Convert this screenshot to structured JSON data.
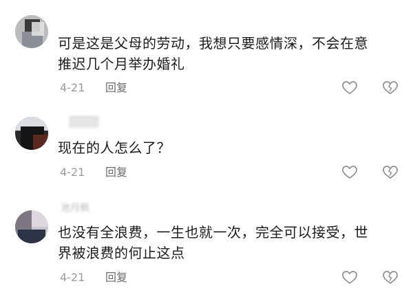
{
  "comments": [
    {
      "username": "",
      "text_line1": "可是这是父母的劳动，我想只要感情深，不会在意",
      "text_line2": "推迟几个月举办婚礼",
      "date": "4-21",
      "reply_label": "回复",
      "like_icon": "heart-outline-icon",
      "dislike_icon": "broken-heart-outline-icon"
    },
    {
      "username": "",
      "text_line1": "现在的人怎么了？",
      "date": "4-21",
      "reply_label": "回复",
      "like_icon": "heart-outline-icon",
      "dislike_icon": "broken-heart-outline-icon"
    },
    {
      "username": "池月枫",
      "text_line1": "也没有全浪费，一生也就一次，完全可以接受，世",
      "text_line2": "界被浪费的何止这点",
      "date": "4-21",
      "reply_label": "回复",
      "like_icon": "heart-outline-icon",
      "dislike_icon": "broken-heart-outline-icon"
    }
  ],
  "colors": {
    "text": "#1c1c1c",
    "meta": "#9a9a9a",
    "reply": "#6b6b6b",
    "icon_stroke": "#8e8e8e"
  }
}
